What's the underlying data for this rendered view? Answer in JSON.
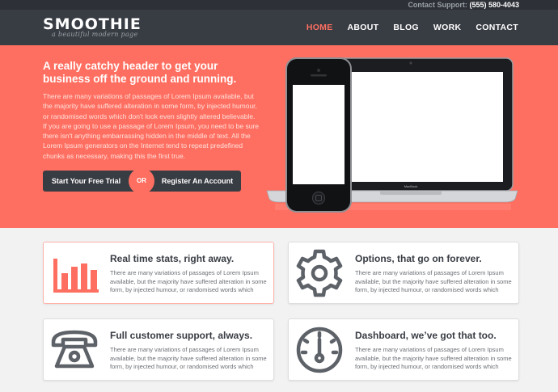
{
  "topbar": {
    "support_label": "Contact Support:",
    "support_phone": "(555) 580-4043"
  },
  "header": {
    "logo": "SMOOTHIE",
    "tagline": "a beautiful modern page",
    "nav": [
      "HOME",
      "ABOUT",
      "BLOG",
      "WORK",
      "CONTACT"
    ],
    "active_nav": "HOME"
  },
  "hero": {
    "title": "A really catchy header to get your business off the ground and running.",
    "body": "There are many variations of passages of Lorem Ipsum available, but the majority have suffered alteration in some form, by injected humour, or randomised words which don't look even slightly altered believable. If you are going to use a passage of Lorem Ipsum, you need to be sure there isn't anything embarrassing hidden in the middle of text. All the Lorem Ipsum generators on the Internet tend to repeat predefined chunks as necessary, making this the first true.",
    "cta_primary": "Start Your Free Trial",
    "cta_or": "OR",
    "cta_secondary": "Register An Account",
    "laptop_brand": "MacBook"
  },
  "colors": {
    "accent": "#ff6f61",
    "dark": "#383c43",
    "icon": "#5d6168"
  },
  "features": [
    {
      "title": "Real time stats, right away.",
      "body": "There are many variations of passages of Lorem Ipsum available, but the majority have suffered alteration in some form, by injected humour, or randomised words which",
      "icon": "bar-chart-icon"
    },
    {
      "title": "Options, that go on forever.",
      "body": "There are many variations of passages of Lorem Ipsum available, but the majority have suffered alteration in some form, by injected humour, or randomised words which",
      "icon": "gear-icon"
    },
    {
      "title": "Full customer support, always.",
      "body": "There are many variations of passages of Lorem Ipsum available, but the majority have suffered alteration in some form, by injected humour, or randomised words which",
      "icon": "telephone-icon"
    },
    {
      "title": "Dashboard, we’ve got that too.",
      "body": "There are many variations of passages of Lorem Ipsum available, but the majority have suffered alteration in some form, by injected humour, or randomised words which",
      "icon": "dashboard-gauge-icon"
    }
  ]
}
